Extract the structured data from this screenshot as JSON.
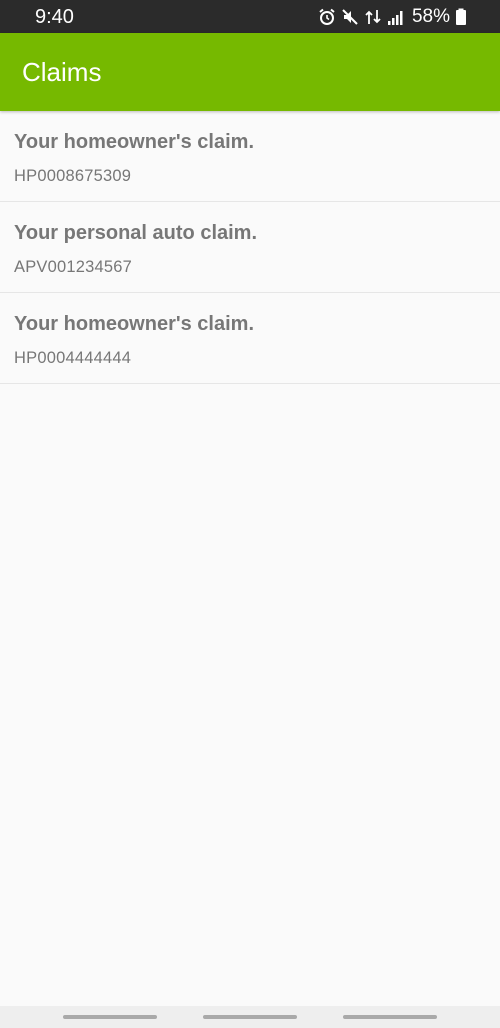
{
  "status_bar": {
    "time": "9:40",
    "icons": [
      "alarm-icon",
      "mute-icon",
      "data-transfer-icon",
      "signal-icon",
      "battery-icon"
    ],
    "battery_percent": "58%"
  },
  "app_bar": {
    "title": "Claims",
    "color": "#76b900"
  },
  "claims": [
    {
      "title": "Your homeowner's claim.",
      "number": "HP0008675309"
    },
    {
      "title": "Your personal auto claim.",
      "number": "APV001234567"
    },
    {
      "title": "Your homeowner's claim.",
      "number": "HP0004444444"
    }
  ],
  "nav_bar": {
    "buttons": [
      "recent-apps",
      "home",
      "back"
    ]
  }
}
